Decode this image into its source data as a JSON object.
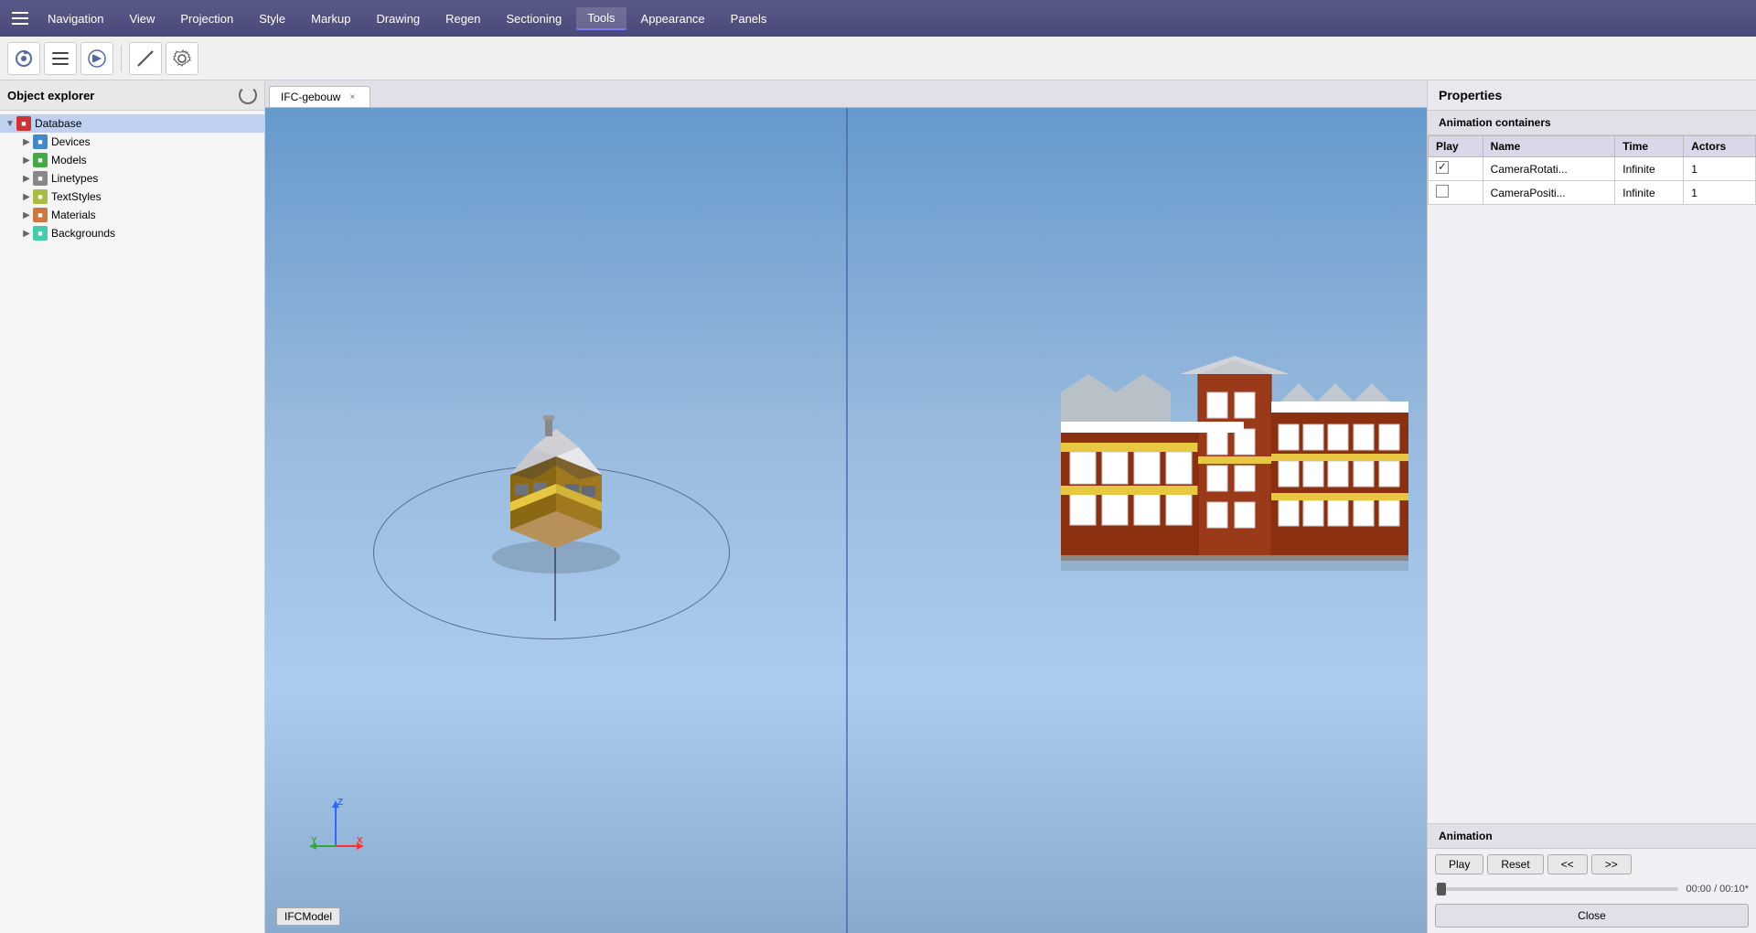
{
  "menubar": {
    "items": [
      {
        "label": "Navigation",
        "active": false
      },
      {
        "label": "View",
        "active": false
      },
      {
        "label": "Projection",
        "active": false
      },
      {
        "label": "Style",
        "active": false
      },
      {
        "label": "Markup",
        "active": false
      },
      {
        "label": "Drawing",
        "active": false
      },
      {
        "label": "Regen",
        "active": false
      },
      {
        "label": "Sectioning",
        "active": false
      },
      {
        "label": "Tools",
        "active": true
      },
      {
        "label": "Appearance",
        "active": false
      },
      {
        "label": "Panels",
        "active": false
      }
    ]
  },
  "sidebar": {
    "title": "Object explorer",
    "tree": [
      {
        "id": "database",
        "label": "Database",
        "indent": 0,
        "expanded": true,
        "icon": "db",
        "selected": true
      },
      {
        "id": "devices",
        "label": "Devices",
        "indent": 1,
        "expanded": false,
        "icon": "devices"
      },
      {
        "id": "models",
        "label": "Models",
        "indent": 1,
        "expanded": false,
        "icon": "models"
      },
      {
        "id": "linetypes",
        "label": "Linetypes",
        "indent": 1,
        "expanded": false,
        "icon": "linetypes"
      },
      {
        "id": "textstyles",
        "label": "TextStyles",
        "indent": 1,
        "expanded": false,
        "icon": "textstyles"
      },
      {
        "id": "materials",
        "label": "Materials",
        "indent": 1,
        "expanded": false,
        "icon": "materials"
      },
      {
        "id": "backgrounds",
        "label": "Backgrounds",
        "indent": 1,
        "expanded": false,
        "icon": "backgrounds"
      }
    ]
  },
  "tab": {
    "label": "IFC-gebouw",
    "close_icon": "×"
  },
  "viewport": {
    "label": "IFCModel"
  },
  "properties": {
    "title": "Properties",
    "anim_containers_label": "Animation containers",
    "table": {
      "columns": [
        "Play",
        "Name",
        "Time",
        "Actors"
      ],
      "rows": [
        {
          "play": true,
          "name": "CameraRotati...",
          "time": "Infinite",
          "actors": "1"
        },
        {
          "play": false,
          "name": "CameraPositi...",
          "time": "Infinite",
          "actors": "1"
        }
      ]
    },
    "animation_label": "Animation",
    "controls": {
      "play": "Play",
      "reset": "Reset",
      "prev": "<<",
      "next": ">>",
      "time": "00:00 / 00:10*",
      "close": "Close"
    }
  }
}
